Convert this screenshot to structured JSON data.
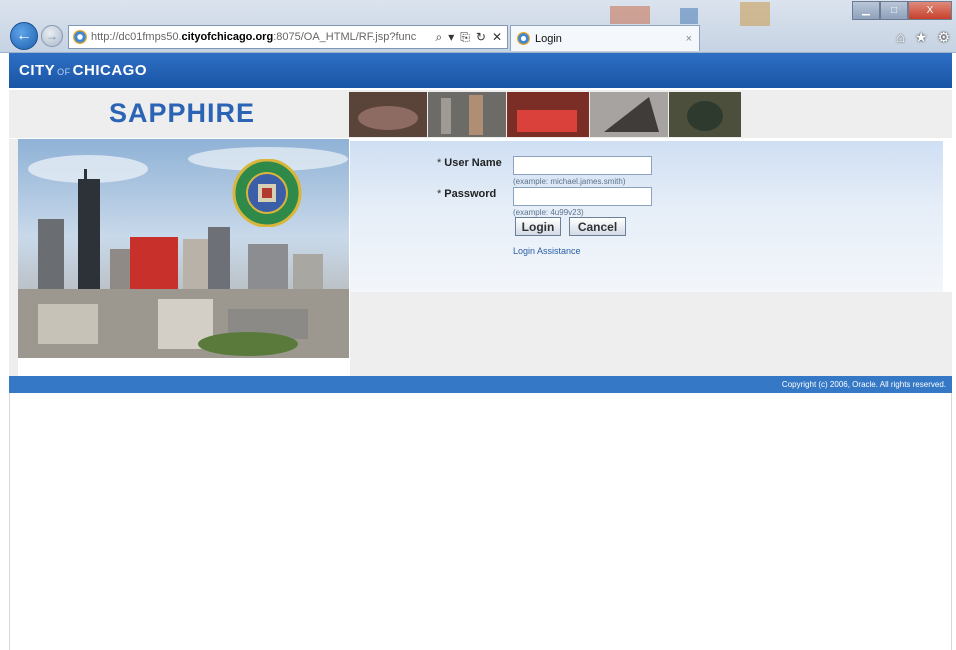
{
  "browser": {
    "url_prefix": "http://dc01fmps50.",
    "url_domain": "cityofchicago.org",
    "url_suffix": ":8075/OA_HTML/RF.jsp?func",
    "address_tools": [
      "⌕",
      "▾",
      "⎘",
      "↻",
      "✕"
    ],
    "tab_title": "Login",
    "tab_close": "×",
    "back_glyph": "←",
    "forward_glyph": "→",
    "window_controls": {
      "minimize": "▁",
      "maximize": "□",
      "close": "X"
    },
    "toolbar_icons": {
      "home": "⌂",
      "favorites": "★",
      "settings": "⚙"
    }
  },
  "header": {
    "city_label_1": "CITY",
    "city_label_of": "OF",
    "city_label_2": "CHICAGO",
    "app_title": "SAPPHIRE"
  },
  "login": {
    "username_label": "User Name",
    "password_label": "Password",
    "required_marker": "*",
    "username_value": "",
    "password_value": "",
    "username_hint": "(example: michael.james.smith)",
    "password_hint": "(example: 4u99v23)",
    "login_button": "Login",
    "cancel_button": "Cancel",
    "assistance_link": "Login Assistance"
  },
  "footer": {
    "copyright": "Copyright (c) 2006, Oracle. All rights reserved."
  },
  "colors": {
    "city_bar": "#1a55a6",
    "sapphire_text": "#2c64b5",
    "footer_bar": "#3478c6",
    "login_panel": "#cfdff3"
  }
}
